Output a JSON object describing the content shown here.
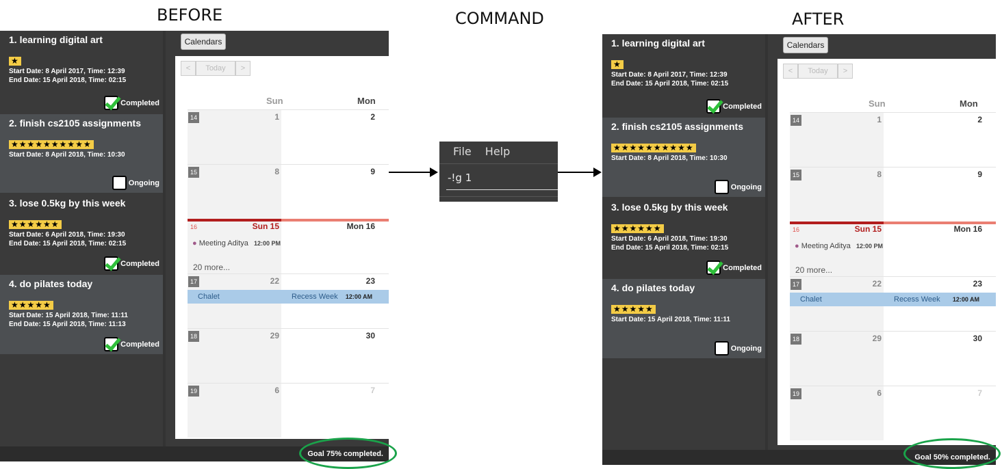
{
  "headings": {
    "before": "BEFORE",
    "command": "COMMAND",
    "after": "AFTER"
  },
  "before": {
    "goals": [
      {
        "title": "1.  learning digital art",
        "stars": "★",
        "dates": [
          "Start Date: 8 April 2017,  Time: 12:39",
          "End Date: 15 April 2018,  Time: 02:15"
        ],
        "status": "Completed"
      },
      {
        "title": "2.  finish cs2105 assignments",
        "stars": "★★★★★★★★★★",
        "dates": [
          "Start Date: 8 April 2018,  Time: 10:30"
        ],
        "status": "Ongoing"
      },
      {
        "title": "3.  lose 0.5kg by this week",
        "stars": "★★★★★★",
        "dates": [
          "Start Date: 6 April 2018,  Time: 19:30",
          "End Date: 15 April 2018,  Time: 02:15"
        ],
        "status": "Completed"
      },
      {
        "title": "4.  do pilates today",
        "stars": "★★★★★",
        "dates": [
          "Start Date: 15 April 2018,  Time: 11:11",
          "End Date: 15 April 2018,  Time: 11:13"
        ],
        "status": "Completed"
      }
    ],
    "goal_summary": "Goal 75% completed."
  },
  "after": {
    "goals": [
      {
        "title": "1.  learning digital art",
        "stars": "★",
        "dates": [
          "Start Date: 8 April 2017,  Time: 12:39",
          "End Date: 15 April 2018,  Time: 02:15"
        ],
        "status": "Completed"
      },
      {
        "title": "2.  finish cs2105 assignments",
        "stars": "★★★★★★★★★★",
        "dates": [
          "Start Date: 8 April 2018,  Time: 10:30"
        ],
        "status": "Ongoing"
      },
      {
        "title": "3.  lose 0.5kg by this week",
        "stars": "★★★★★★",
        "dates": [
          "Start Date: 6 April 2018,  Time: 19:30",
          "End Date: 15 April 2018,  Time: 02:15"
        ],
        "status": "Completed"
      },
      {
        "title": "4.  do pilates today",
        "stars": "★★★★★",
        "dates": [
          "Start Date: 15 April 2018,  Time: 11:11"
        ],
        "status": "Ongoing"
      }
    ],
    "goal_summary": "Goal 50% completed."
  },
  "calendar": {
    "button": "Calendars",
    "nav": {
      "prev": "<",
      "today": "Today",
      "next": ">"
    },
    "day_headers": [
      "Sun",
      "Mon"
    ],
    "weeks": [
      {
        "wk": "14",
        "sun": "1",
        "mon": "2"
      },
      {
        "wk": "15",
        "sun": "8",
        "mon": "9"
      },
      {
        "wk": "16",
        "sun": "Sun 15",
        "mon": "Mon 16"
      },
      {
        "wk": "17",
        "sun": "22",
        "mon": "23"
      },
      {
        "wk": "18",
        "sun": "29",
        "mon": "30"
      },
      {
        "wk": "19",
        "sun": "6",
        "mon": "7"
      }
    ],
    "event_meeting": "Meeting Aditya",
    "event_meeting_time": "12:00 PM",
    "more": "20 more...",
    "band_left": "Chalet",
    "band_right": "Recess Week",
    "band_time": "12:00 AM"
  },
  "command": {
    "menu": [
      "File",
      "Help"
    ],
    "input": "-!g 1"
  },
  "colors": {
    "star_bg": "#f4cc46",
    "check": "#2fbf3a",
    "ring": "#1aa34a",
    "today_red": "#b21e1e",
    "band": "#aacbe8"
  }
}
